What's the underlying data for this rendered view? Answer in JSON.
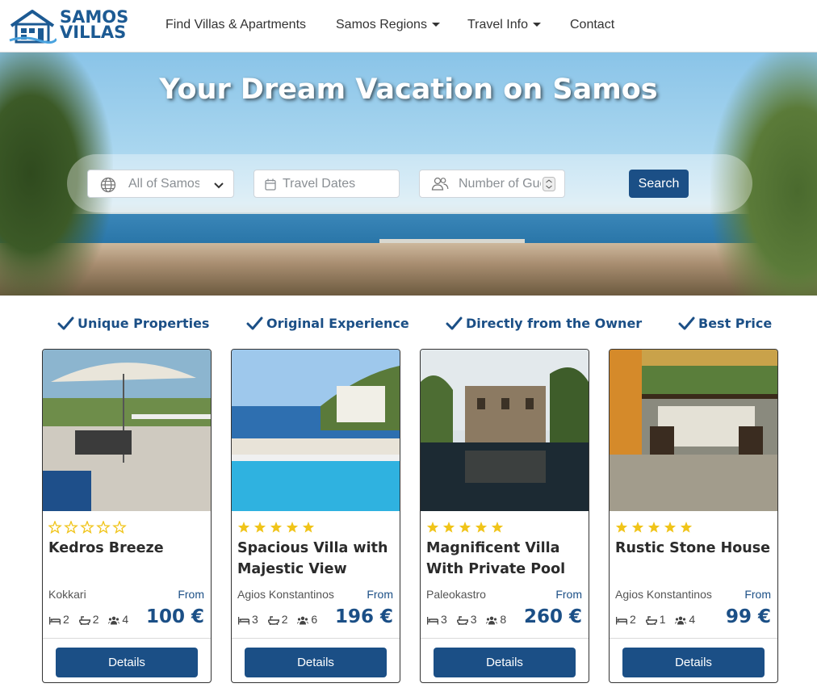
{
  "brand": {
    "line1": "SAMOS",
    "line2": "VILLAS",
    "color": "#1c5a93"
  },
  "nav": {
    "items": [
      {
        "label": "Find Villas & Apartments",
        "dropdown": false
      },
      {
        "label": "Samos Regions",
        "dropdown": true
      },
      {
        "label": "Travel Info",
        "dropdown": true
      },
      {
        "label": "Contact",
        "dropdown": false
      }
    ]
  },
  "hero": {
    "title": "Your Dream Vacation on Samos",
    "search": {
      "region_value": "All of Samos",
      "dates_placeholder": "Travel Dates",
      "guests_placeholder": "Number of Guests",
      "button_label": "Search"
    }
  },
  "features": [
    "Unique Properties",
    "Original Experience",
    "Directly from the Owner",
    "Best Price"
  ],
  "colors": {
    "accent": "#1b4f86",
    "star": "#f0c419"
  },
  "listings": [
    {
      "name": "Kedros Breeze",
      "rating": 0,
      "location": "Kokkari",
      "from_label": "From",
      "bedrooms": "2",
      "bathrooms": "2",
      "guests": "4",
      "price": "100 €",
      "button": "Details"
    },
    {
      "name": "Spacious Villa with Majestic View",
      "rating": 5,
      "location": "Agios Konstantinos",
      "from_label": "From",
      "bedrooms": "3",
      "bathrooms": "2",
      "guests": "6",
      "price": "196 €",
      "button": "Details"
    },
    {
      "name": "Magnificent Villa With Private Pool",
      "rating": 5,
      "location": "Paleokastro",
      "from_label": "From",
      "bedrooms": "3",
      "bathrooms": "3",
      "guests": "8",
      "price": "260 €",
      "button": "Details"
    },
    {
      "name": "Rustic Stone House",
      "rating": 5,
      "location": "Agios Konstantinos",
      "from_label": "From",
      "bedrooms": "2",
      "bathrooms": "1",
      "guests": "4",
      "price": "99 €",
      "button": "Details"
    }
  ]
}
